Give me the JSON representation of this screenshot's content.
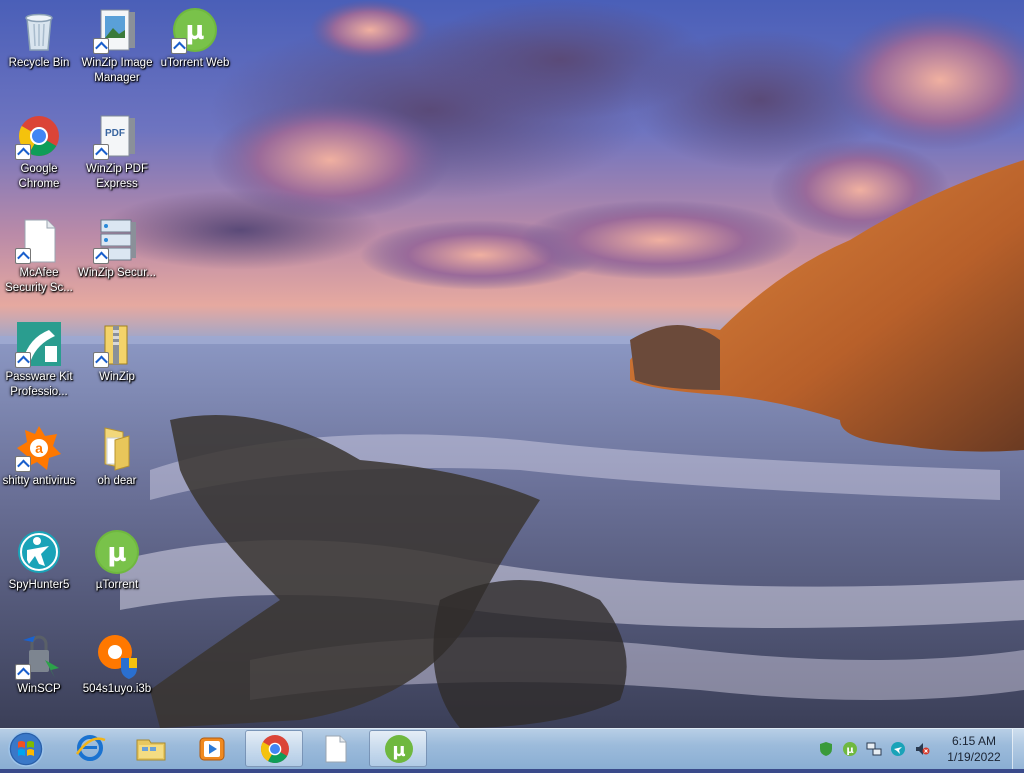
{
  "desktop": {
    "icons": [
      {
        "label": "Recycle Bin",
        "icon": "recycle-bin-icon"
      },
      {
        "label": "WinZip Image Manager",
        "icon": "winzip-image-manager-icon"
      },
      {
        "label": "uTorrent Web",
        "icon": "utorrent-web-icon"
      },
      {
        "label": "Google Chrome",
        "icon": "chrome-icon"
      },
      {
        "label": "WinZip PDF Express",
        "icon": "pdf-icon"
      },
      {
        "label": "McAfee Security Sc...",
        "icon": "document-icon"
      },
      {
        "label": "WinZip Secur...",
        "icon": "server-icon"
      },
      {
        "label": "Passware Kit Professio...",
        "icon": "passware-icon"
      },
      {
        "label": "WinZip",
        "icon": "winzip-icon"
      },
      {
        "label": "shitty antivirus",
        "icon": "avast-icon"
      },
      {
        "label": "oh dear",
        "icon": "folder-icon"
      },
      {
        "label": "SpyHunter5",
        "icon": "spyhunter-icon"
      },
      {
        "label": "µTorrent",
        "icon": "utorrent-icon"
      },
      {
        "label": "WinSCP",
        "icon": "winscp-icon"
      },
      {
        "label": "504s1uyo.i3b",
        "icon": "avast-shield-icon"
      }
    ]
  },
  "taskbar": {
    "start": "start-button-icon",
    "pinned": [
      "internet-explorer-icon",
      "file-explorer-icon",
      "media-player-icon",
      "chrome-icon",
      "document-icon",
      "utorrent-icon"
    ]
  },
  "tray": {
    "time": "6:15 AM",
    "date": "1/19/2022"
  },
  "colors": {
    "utorrent_green": "#6fb83f",
    "chrome_red": "#db4437",
    "chrome_yellow": "#f4c20d",
    "chrome_green": "#0f9d58",
    "chrome_blue": "#4285f4",
    "avast_orange": "#ff7800",
    "taskbar": "#9cbbdb"
  }
}
